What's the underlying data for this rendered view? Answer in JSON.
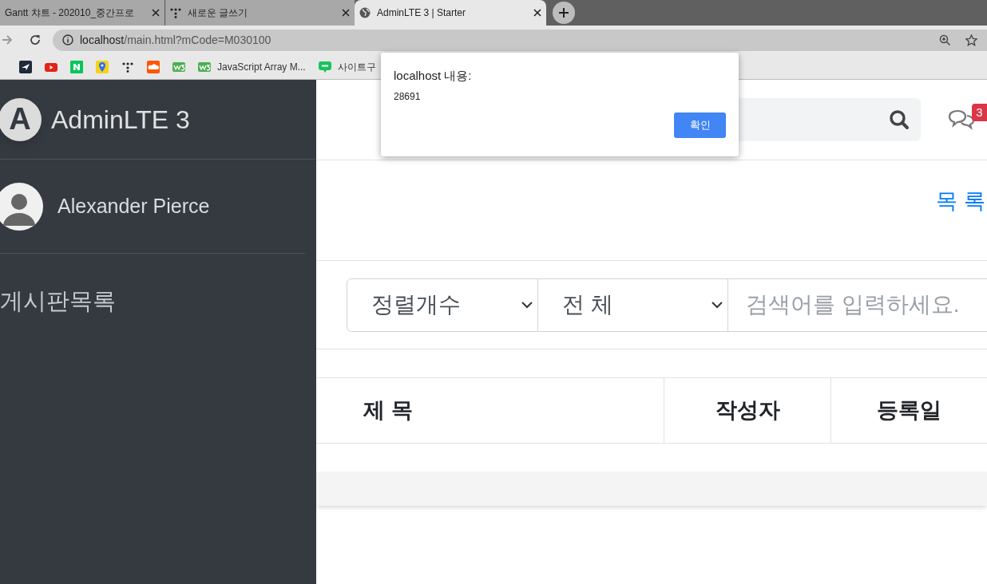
{
  "browser": {
    "tabs": [
      {
        "title": "Gantt 챠트 - 202010_중간프로",
        "selected": false
      },
      {
        "title": "새로운 글쓰기",
        "selected": false
      },
      {
        "title": "AdminLTE 3 | Starter",
        "selected": true
      }
    ],
    "url_host": "localhost",
    "url_path": "/main.html?mCode=M030100",
    "bookmarks": [
      {
        "kind": "icon"
      },
      {
        "kind": "icon"
      },
      {
        "kind": "icon"
      },
      {
        "kind": "icon"
      },
      {
        "kind": "icon"
      },
      {
        "kind": "icon"
      },
      {
        "kind": "icon"
      },
      {
        "kind": "link",
        "label": "JavaScript Array M..."
      },
      {
        "kind": "link",
        "label": "사이트구"
      }
    ]
  },
  "sidebar": {
    "logo_letter": "A",
    "brand": "AdminLTE 3",
    "user": "Alexander Pierce",
    "menu": [
      {
        "label": "게시판목록"
      }
    ]
  },
  "navbar": {
    "messages_badge": "3"
  },
  "content": {
    "list_link": "목 록",
    "sort_select": "정렬개수",
    "filter_select": "전 체",
    "search": {
      "placeholder": "검색어를 입력하세요."
    },
    "table": {
      "columns": [
        "제 목",
        "작성자",
        "등록일"
      ]
    }
  },
  "dialog": {
    "title": "localhost 내용:",
    "message": "28691",
    "ok": "확인"
  }
}
